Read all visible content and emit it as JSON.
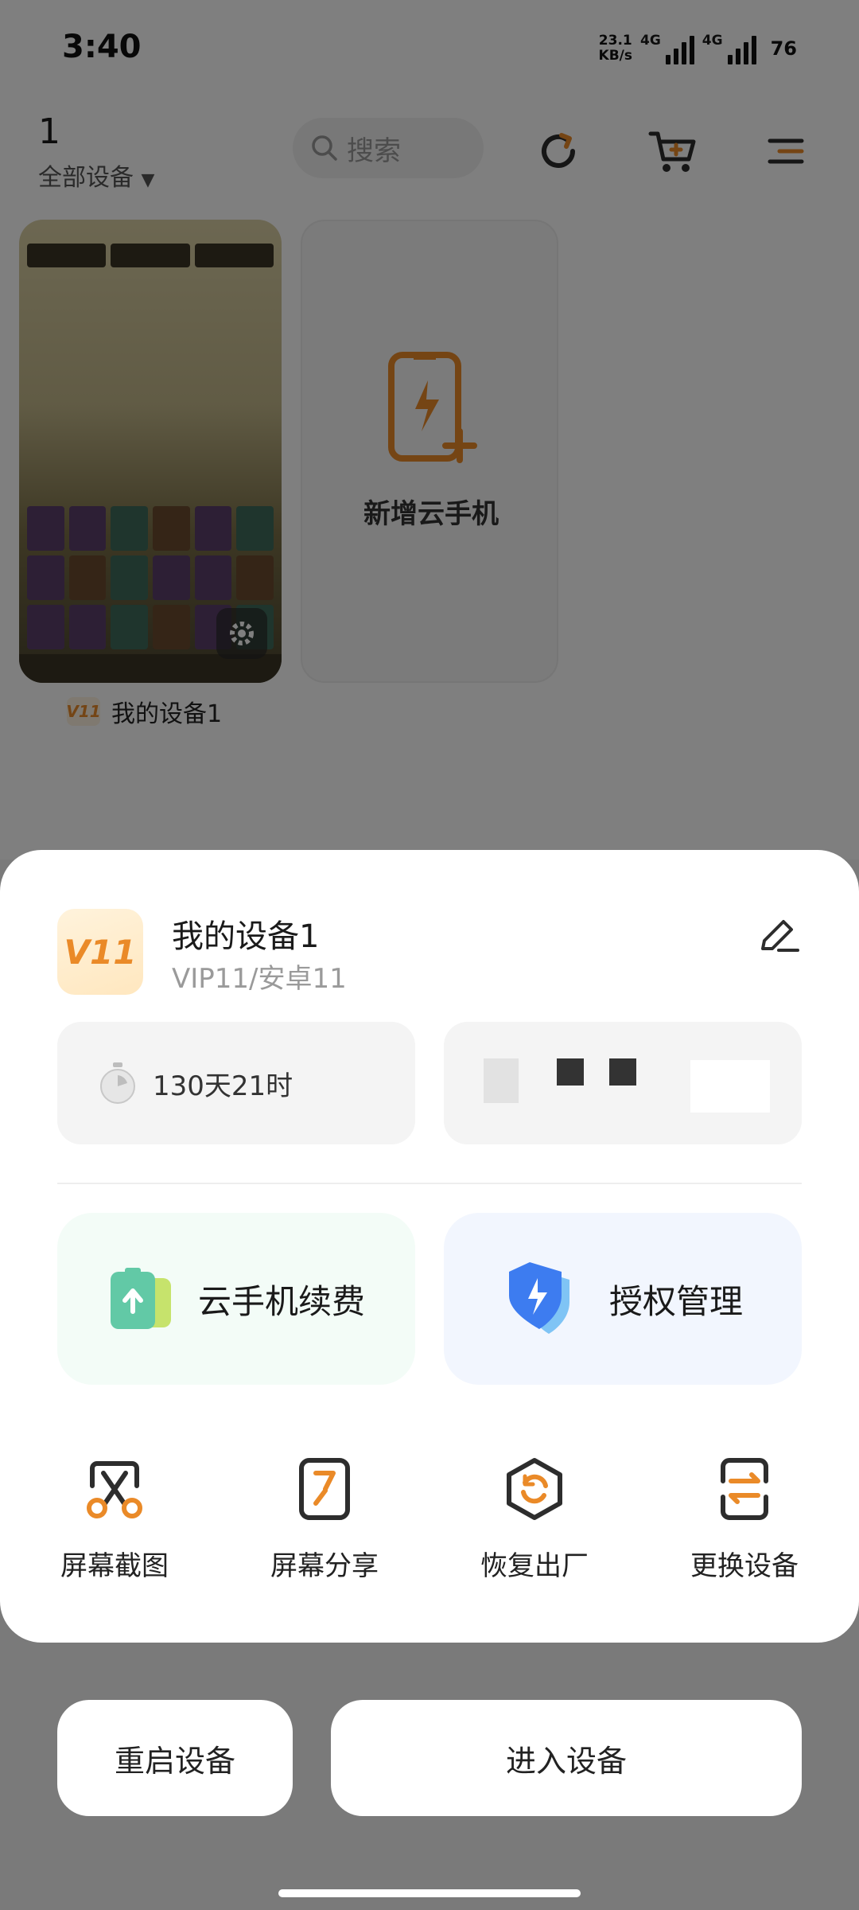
{
  "status_bar": {
    "time": "3:40",
    "net_speed_value": "23.1",
    "net_speed_unit": "KB/s",
    "signal1": "4G",
    "signal2": "4G",
    "battery": "76"
  },
  "header": {
    "device_count": "1",
    "filter_label": "全部设备",
    "search_placeholder": "搜索"
  },
  "device_list": {
    "add_label": "新增云手机",
    "device_caption": "我的设备1",
    "caption_badge": "V11"
  },
  "sheet": {
    "badge": "V11",
    "device_name": "我的设备1",
    "device_sub": "VIP11/安卓11",
    "remaining_time": "130天21时",
    "renew_label": "云手机续费",
    "auth_label": "授权管理",
    "tools": [
      "屏幕截图",
      "屏幕分享",
      "恢复出厂",
      "更换设备"
    ]
  },
  "actions": {
    "restart_label": "重启设备",
    "enter_label": "进入设备"
  },
  "colors": {
    "accent_orange": "#ea8a28",
    "icon_dark": "#2d2d2d",
    "renew_bg": "#f3fcf7",
    "auth_bg": "#f2f6fe",
    "shield_blue": "#3d7cf0"
  },
  "icons": [
    "search-icon",
    "refresh-icon",
    "cart-icon",
    "menu-icon",
    "settings-gear-icon",
    "phone-add-icon",
    "edit-icon",
    "stopwatch-icon",
    "renew-card-icon",
    "shield-bolt-icon",
    "screenshot-scissors-icon",
    "screen-share-icon",
    "factory-reset-icon",
    "swap-device-icon"
  ]
}
